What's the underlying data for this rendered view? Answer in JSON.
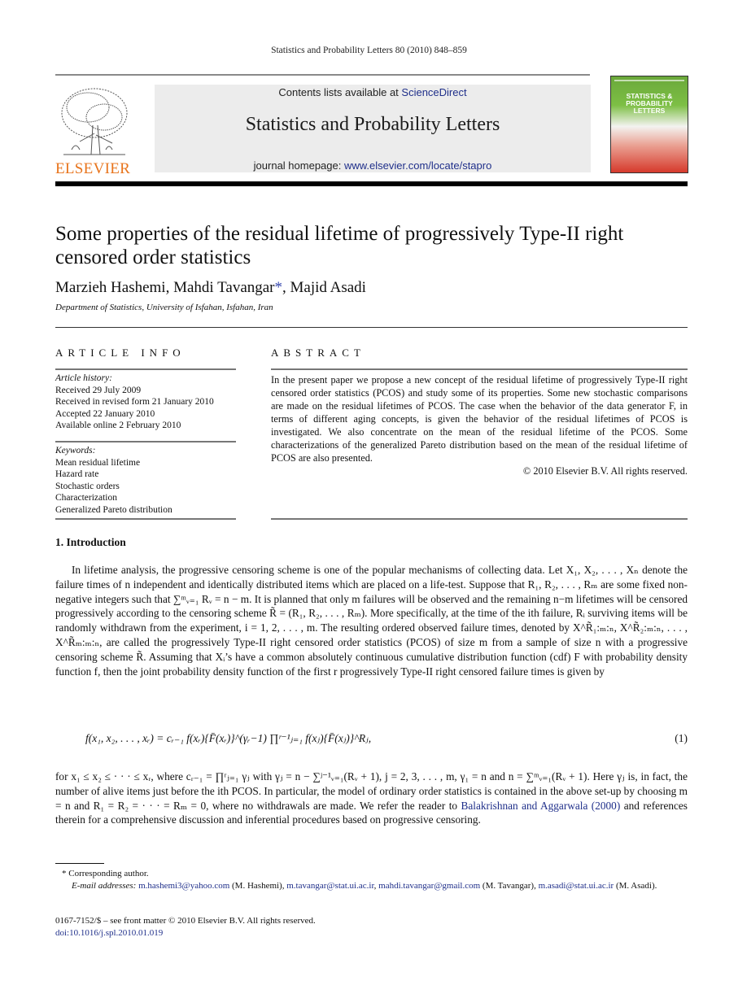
{
  "running_header": "Statistics and Probability Letters 80 (2010) 848–859",
  "banner": {
    "contents_prefix": "Contents lists available at ",
    "contents_link": "ScienceDirect",
    "journal_title": "Statistics and Probability Letters",
    "homepage_prefix": "journal homepage: ",
    "homepage_link": "www.elsevier.com/locate/stapro"
  },
  "publisher": {
    "wordmark": "ELSEVIER",
    "color": "#e8741c"
  },
  "cover": {
    "lines": [
      "STATISTICS &",
      "PROBABILITY",
      "LETTERS"
    ]
  },
  "article": {
    "title": "Some properties of the residual lifetime of progressively Type-II right censored order statistics",
    "authors": [
      "Marzieh Hashemi",
      "Mahdi Tavangar",
      "Majid Asadi"
    ],
    "corresponding_mark": "*",
    "affiliation": "Department of Statistics, University of Isfahan, Isfahan, Iran"
  },
  "article_info": {
    "heading": "ARTICLE INFO",
    "history_label": "Article history:",
    "history": [
      "Received 29 July 2009",
      "Received in revised form 21 January 2010",
      "Accepted 22 January 2010",
      "Available online 2 February 2010"
    ],
    "keywords_label": "Keywords:",
    "keywords": [
      "Mean residual lifetime",
      "Hazard rate",
      "Stochastic orders",
      "Characterization",
      "Generalized Pareto distribution"
    ]
  },
  "abstract": {
    "heading": "ABSTRACT",
    "text": "In the present paper we propose a new concept of the residual lifetime of progressively Type-II right censored order statistics (PCOS) and study some of its properties. Some new stochastic comparisons are made on the residual lifetimes of PCOS. The case when the behavior of the data generator F, in terms of different aging concepts, is given the behavior of the residual lifetimes of PCOS is investigated. We also concentrate on the mean of the residual lifetime of the PCOS. Some characterizations of the generalized Pareto distribution based on the mean of the residual lifetime of PCOS are also presented.",
    "copyright": "© 2010 Elsevier B.V. All rights reserved."
  },
  "intro": {
    "heading": "1.  Introduction",
    "para1": "In lifetime analysis, the progressive censoring scheme is one of the popular mechanisms of collecting data. Let X₁, X₂, . . . , Xₙ denote the failure times of n independent and identically distributed items which are placed on a life-test. Suppose that R₁, R₂, . . . , Rₘ are some fixed non-negative integers such that ∑ᵐᵥ₌₁ Rᵥ = n − m. It is planned that only m failures will be observed and the remaining n−m lifetimes will be censored progressively according to the censoring scheme R̃ = (R₁, R₂, . . . , Rₘ). More specifically, at the time of the ith failure, Rᵢ surviving items will be randomly withdrawn from the experiment, i = 1, 2, . . . , m. The resulting ordered observed failure times, denoted by X^R̃₁:ₘ:ₙ, X^R̃₂:ₘ:ₙ, . . . , X^R̃ₘ:ₘ:ₙ, are called the progressively Type-II right censored order statistics (PCOS) of size m from a sample of size n with a progressive censoring scheme R̃. Assuming that Xᵢ’s have a common absolutely continuous cumulative distribution function (cdf) F with probability density function f, then the joint probability density function of the first r progressively Type-II right censored failure times is given by",
    "equation": "f(x₁, x₂, . . . , xᵣ) = cᵣ₋₁ f(xᵣ){F̄(xᵣ)}^(γᵣ−1) ∏ʳ⁻¹ⱼ₌₁ f(xⱼ){F̄(xⱼ)}^Rⱼ,",
    "equation_number": "(1)",
    "para2_a": "for x₁ ≤ x₂ ≤ · · · ≤ xᵣ, where cᵣ₋₁ = ∏ʳⱼ₌₁ γⱼ with γⱼ = n − ∑ʲ⁻¹ᵥ₌₁(Rᵥ + 1), j = 2, 3, . . . , m, γ₁ = n and n = ∑ᵐᵥ₌₁(Rᵥ + 1). Here γⱼ is, in fact, the number of alive items just before the ith PCOS. In particular, the model of ordinary order statistics is contained in the above set-up by choosing m = n and R₁ = R₂ = · · · = Rₘ = 0, where no withdrawals are made. We refer the reader to ",
    "para2_link": "Balakrishnan and Aggarwala (2000)",
    "para2_b": " and references therein for a comprehensive discussion and inferential procedures based on progressive censoring."
  },
  "footnotes": {
    "corresponding": "Corresponding author.",
    "email_label": "E-mail addresses: ",
    "emails": [
      {
        "address": "m.hashemi3@yahoo.com",
        "owner": " (M. Hashemi), "
      },
      {
        "address": "m.tavangar@stat.ui.ac.ir",
        "owner": ", "
      },
      {
        "address": "mahdi.tavangar@gmail.com",
        "owner": " (M. Tavangar), "
      },
      {
        "address": "m.asadi@stat.ui.ac.ir",
        "owner": " (M. Asadi)."
      }
    ],
    "front_matter": "0167-7152/$ – see front matter © 2010 Elsevier B.V. All rights reserved.",
    "doi": "doi:10.1016/j.spl.2010.01.019"
  }
}
